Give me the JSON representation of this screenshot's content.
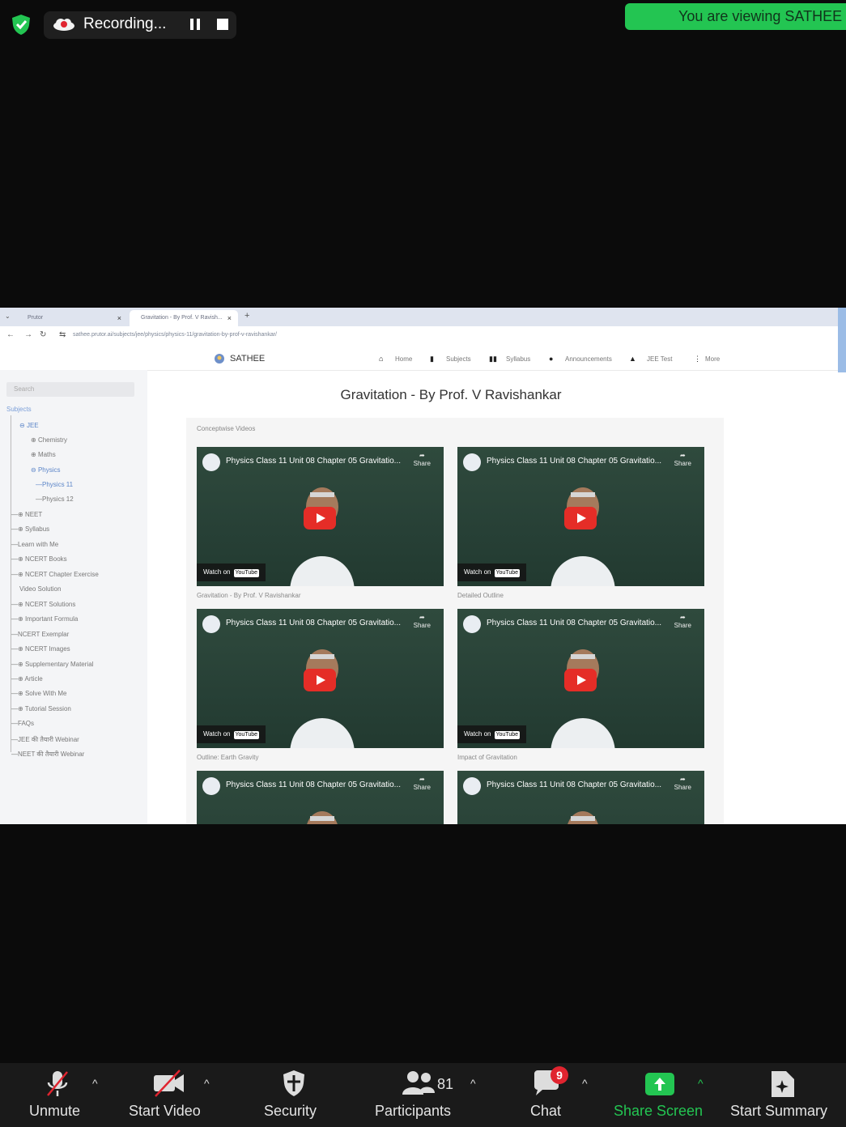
{
  "top_bar": {
    "recording_label": "Recording...",
    "viewing_banner": "You are viewing SATHEE"
  },
  "browser": {
    "tabs": [
      {
        "label": "Prutor"
      },
      {
        "label": "Gravitation - By Prof. V Ravish..."
      }
    ],
    "url": "sathee.prutor.ai/subjects/jee/physics/physics-11/gravitation-by-prof-v-ravishankar/"
  },
  "site_nav": {
    "logo": "SATHEE",
    "items": [
      "Home",
      "Subjects",
      "Syllabus",
      "Announcements",
      "JEE Test",
      "More"
    ]
  },
  "sidebar": {
    "search_placeholder": "Search",
    "subjects_label": "Subjects",
    "tree": [
      {
        "label": "JEE"
      },
      {
        "label": "Chemistry"
      },
      {
        "label": "Maths"
      },
      {
        "label": "Physics"
      },
      {
        "label": "Physics 11"
      },
      {
        "label": "Physics 12"
      },
      {
        "label": "NEET"
      },
      {
        "label": "Syllabus"
      },
      {
        "label": "Learn with Me"
      },
      {
        "label": "NCERT Books"
      },
      {
        "label": "NCERT Chapter Exercise"
      },
      {
        "label": "Video Solution"
      },
      {
        "label": "NCERT Solutions"
      },
      {
        "label": "Important Formula"
      },
      {
        "label": "NCERT Exemplar"
      },
      {
        "label": "NCERT Images"
      },
      {
        "label": "Supplementary Material"
      },
      {
        "label": "Article"
      },
      {
        "label": "Solve With Me"
      },
      {
        "label": "Tutorial Session"
      },
      {
        "label": "FAQs"
      },
      {
        "label": "JEE की तैयारी Webinar"
      },
      {
        "label": "NEET की तैयारी Webinar"
      }
    ]
  },
  "content": {
    "page_title": "Gravitation - By Prof. V Ravishankar",
    "section_label": "Conceptwise Videos",
    "video_title": "Physics Class 11 Unit 08 Chapter 05 Gravitatio...",
    "share_label": "Share",
    "watch_on": "Watch on",
    "youtube": "YouTube",
    "captions": [
      "Gravitation - By Prof. V Ravishankar",
      "Detailed Outline",
      "Outline: Earth Gravity",
      "Impact of Gravitation"
    ]
  },
  "toolbar": {
    "unmute": "Unmute",
    "start_video": "Start Video",
    "security": "Security",
    "participants": "Participants",
    "participants_count": "81",
    "chat": "Chat",
    "chat_badge": "9",
    "share_screen": "Share Screen",
    "start_summary": "Start Summary"
  },
  "colors": {
    "banner_green": "#23c552",
    "share_green": "#23c552",
    "badge_red": "#e0242f",
    "youtube_red": "#e52d27"
  }
}
